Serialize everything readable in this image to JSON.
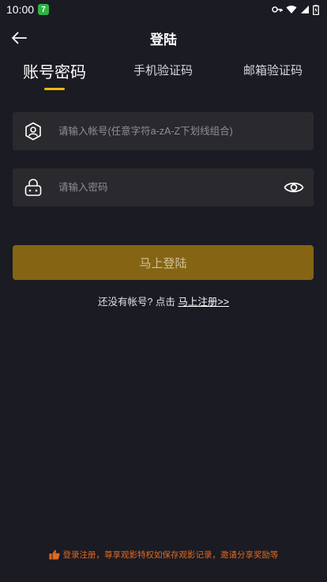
{
  "status_bar": {
    "time": "10:00",
    "app_badge": "7"
  },
  "header": {
    "title": "登陆"
  },
  "tabs": [
    {
      "label": "账号密码",
      "active": true
    },
    {
      "label": "手机验证码",
      "active": false
    },
    {
      "label": "邮箱验证码",
      "active": false
    }
  ],
  "form": {
    "account_placeholder": "请输入帐号(任意字符a-zA-Z下划线组合)",
    "password_placeholder": "请输入密码",
    "login_label": "马上登陆"
  },
  "register": {
    "prompt": "还没有帐号? 点击 ",
    "link": "马上注册>>"
  },
  "footer": {
    "note": "登录注册，尊享观影特权如保存观影记录，邀请分享奖励等"
  },
  "colors": {
    "background": "#1b1b23",
    "field": "#2a2a2e",
    "accent": "#f5b800",
    "button": "#856514",
    "footer_text": "#e06a1f"
  }
}
